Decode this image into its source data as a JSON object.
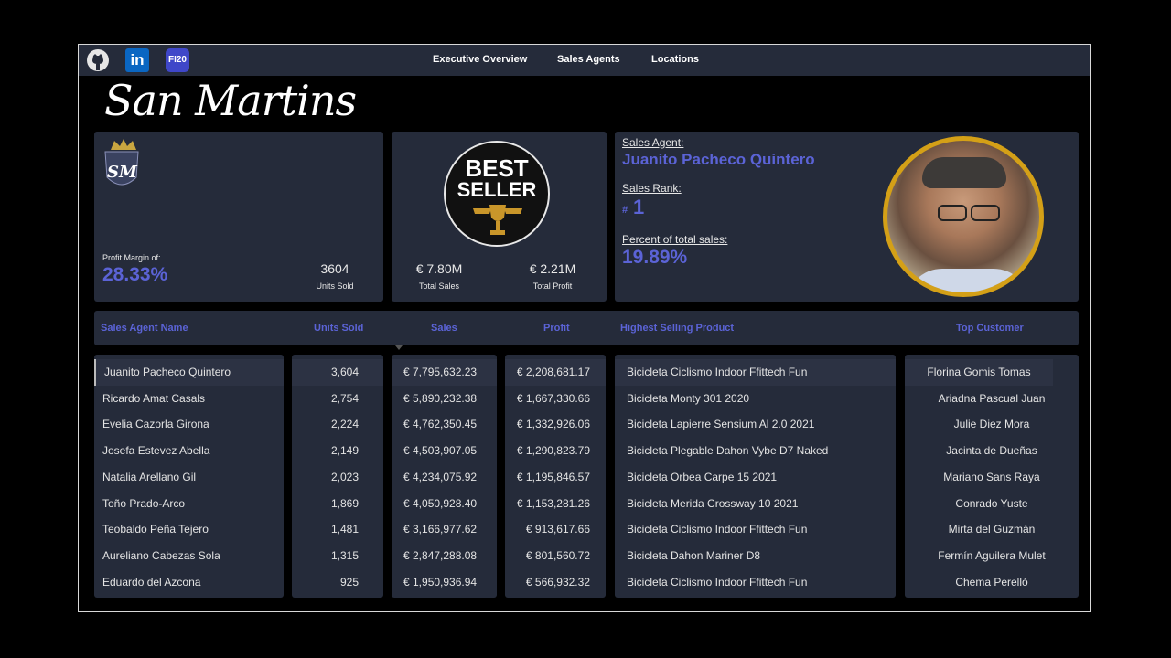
{
  "nav": {
    "items": [
      "Executive Overview",
      "Sales Agents",
      "Locations"
    ]
  },
  "social": {
    "linkedin_text": "in",
    "fi_text": "FI20"
  },
  "brand": {
    "title": "San Martins",
    "logo_text": "SM"
  },
  "kpis": {
    "profit_margin_label": "Profit Margin of:",
    "profit_margin_value": "28.33%",
    "units_sold_value": "3604",
    "units_sold_label": "Units Sold",
    "total_sales_value": "€ 7.80M",
    "total_sales_label": "Total Sales",
    "total_profit_value": "€ 2.21M",
    "total_profit_label": "Total Profit"
  },
  "badge": {
    "line1": "BEST",
    "line2": "SELLER"
  },
  "agent": {
    "label": "Sales Agent:",
    "name": "Juanito Pacheco Quintero",
    "rank_label": "Sales Rank:",
    "rank_prefix": "#",
    "rank_value": "1",
    "percent_label": "Percent of total sales:",
    "percent_value": "19.89%"
  },
  "table": {
    "headers": {
      "name": "Sales Agent Name",
      "units": "Units Sold",
      "sales": "Sales",
      "profit": "Profit",
      "product": "Highest Selling Product",
      "customer": "Top Customer"
    },
    "rows": [
      {
        "name": "Juanito Pacheco Quintero",
        "units": "3,604",
        "sales": "€ 7,795,632.23",
        "profit": "€ 2,208,681.17",
        "product": "Bicicleta Ciclismo Indoor Ffittech Fun",
        "customer": "Florina Gomis Tomas"
      },
      {
        "name": "Ricardo Amat Casals",
        "units": "2,754",
        "sales": "€ 5,890,232.38",
        "profit": "€ 1,667,330.66",
        "product": "Bicicleta Monty 301 2020",
        "customer": "Ariadna Pascual Juan"
      },
      {
        "name": "Evelia Cazorla Girona",
        "units": "2,224",
        "sales": "€ 4,762,350.45",
        "profit": "€ 1,332,926.06",
        "product": "Bicicleta Lapierre Sensium Al 2.0 2021",
        "customer": "Julie Diez Mora"
      },
      {
        "name": "Josefa Estevez Abella",
        "units": "2,149",
        "sales": "€ 4,503,907.05",
        "profit": "€ 1,290,823.79",
        "product": "Bicicleta Plegable Dahon Vybe D7 Naked",
        "customer": "Jacinta de Dueñas"
      },
      {
        "name": "Natalia Arellano Gil",
        "units": "2,023",
        "sales": "€ 4,234,075.92",
        "profit": "€ 1,195,846.57",
        "product": "Bicicleta Orbea Carpe 15 2021",
        "customer": "Mariano Sans Raya"
      },
      {
        "name": "Toño Prado-Arco",
        "units": "1,869",
        "sales": "€ 4,050,928.40",
        "profit": "€ 1,153,281.26",
        "product": "Bicicleta Merida Crossway 10 2021",
        "customer": "Conrado Yuste"
      },
      {
        "name": "Teobaldo Peña Tejero",
        "units": "1,481",
        "sales": "€ 3,166,977.62",
        "profit": "€ 913,617.66",
        "product": "Bicicleta Ciclismo Indoor Ffittech Fun",
        "customer": "Mirta del Guzmán"
      },
      {
        "name": "Aureliano Cabezas Sola",
        "units": "1,315",
        "sales": "€ 2,847,288.08",
        "profit": "€ 801,560.72",
        "product": "Bicicleta Dahon Mariner D8",
        "customer": "Fermín Aguilera Mulet"
      },
      {
        "name": "Eduardo del Azcona",
        "units": "925",
        "sales": "€ 1,950,936.94",
        "profit": "€ 566,932.32",
        "product": "Bicicleta Ciclismo Indoor Ffittech Fun",
        "customer": "Chema Perelló"
      }
    ]
  },
  "colors": {
    "accent": "#5b63d6",
    "card": "#252b3a",
    "gold": "#d4a017"
  }
}
